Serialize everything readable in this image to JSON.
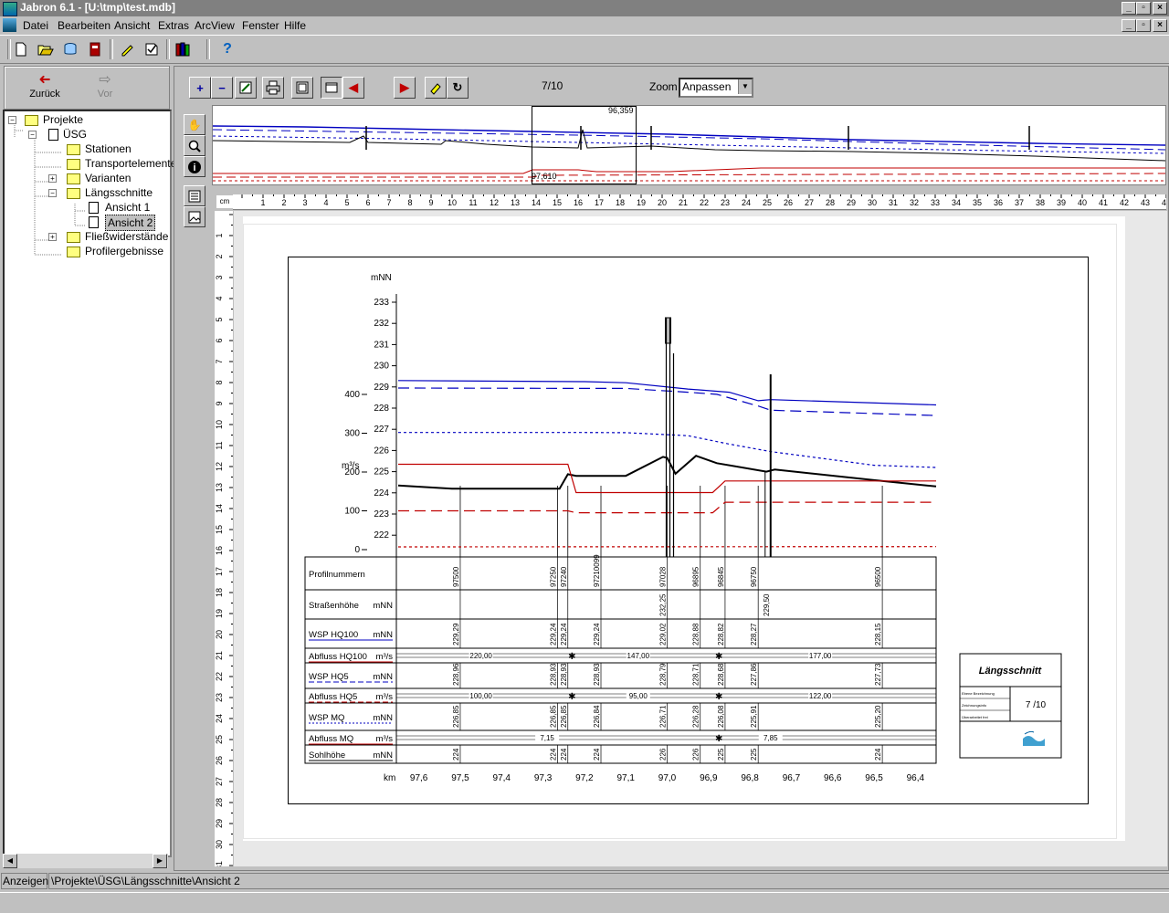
{
  "window": {
    "title": "Jabron 6.1 - [U:\\tmp\\test.mdb]"
  },
  "menu": {
    "items": [
      "Datei",
      "Bearbeiten",
      "Ansicht",
      "Extras",
      "ArcView",
      "Fenster",
      "Hilfe"
    ]
  },
  "nav": {
    "back": "Zurück",
    "forward": "Vor"
  },
  "tree": {
    "root": "Projekte",
    "project": "ÜSG",
    "items": [
      "Stationen",
      "Transportelemente",
      "Varianten",
      "Längsschnitte",
      "Fließwiderstände",
      "Profilergebnisse"
    ],
    "views": [
      "Ansicht 1",
      "Ansicht 2"
    ],
    "selected": "Ansicht 2"
  },
  "viewer": {
    "page": "7/10",
    "zoom_label": "Zoom",
    "zoom_value": "Anpassen",
    "ruler_unit": "cm"
  },
  "overview": {
    "top_value": "96,359",
    "bottom_value": "97,610"
  },
  "status": {
    "mode": "Anzeigen",
    "path": "\\Projekte\\ÜSG\\Längsschnitte\\Ansicht 2"
  },
  "title_block": {
    "title": "Längsschnitt",
    "page": "7 /10",
    "rows": [
      "Ebene Bezeichnung",
      "Zeichnungsinfo",
      "Überarbeitet frei"
    ]
  },
  "colors": {
    "wsp_hq100": "#0000c0",
    "abfluss": "#c00000",
    "ground": "#000000",
    "highlight": "#808080"
  },
  "chart_data": {
    "type": "line",
    "title": "",
    "ylabel": "mNN",
    "ylabel2": "m³/s",
    "xlabel": "km",
    "x_ticks": [
      "97,6",
      "97,5",
      "97,4",
      "97,3",
      "97,2",
      "97,1",
      "97,0",
      "96,9",
      "96,8",
      "96,7",
      "96,6",
      "96,5",
      "96,4"
    ],
    "y_ticks": [
      "222",
      "223",
      "224",
      "225",
      "226",
      "227",
      "228",
      "229",
      "230",
      "231",
      "232",
      "233"
    ],
    "y2_ticks": [
      "0",
      "100",
      "200",
      "300",
      "400"
    ],
    "xlim": [
      97.65,
      96.35
    ],
    "ylim": [
      221,
      233
    ],
    "series": [
      {
        "name": "WSP HQ100",
        "color": "#0000c0",
        "dash": "solid",
        "x": [
          97.65,
          97.2,
          97.1,
          96.95,
          96.85,
          96.78,
          96.75,
          96.35
        ],
        "y": [
          229.3,
          229.25,
          229.2,
          228.9,
          228.75,
          228.35,
          228.4,
          228.15
        ]
      },
      {
        "name": "WSP HQ5",
        "color": "#0000c0",
        "dash": "long",
        "x": [
          97.65,
          97.2,
          97.1,
          96.95,
          96.88,
          96.78,
          96.75,
          96.35
        ],
        "y": [
          228.95,
          228.93,
          228.93,
          228.75,
          228.65,
          228.1,
          227.9,
          227.65
        ]
      },
      {
        "name": "WSP MQ",
        "color": "#0000c0",
        "dash": "short",
        "x": [
          97.65,
          97.2,
          97.1,
          96.95,
          96.85,
          96.75,
          96.5,
          96.35
        ],
        "y": [
          226.85,
          226.85,
          226.84,
          226.7,
          226.3,
          225.95,
          225.3,
          225.2
        ]
      },
      {
        "name": "Sohlhöhe",
        "color": "#000000",
        "dash": "solid",
        "x": [
          97.65,
          97.52,
          97.26,
          97.24,
          97.22,
          97.1,
          97.01,
          97.0,
          96.98,
          96.93,
          96.88,
          96.76,
          96.74,
          96.5,
          96.35
        ],
        "y": [
          224.35,
          224.2,
          224.2,
          224.88,
          224.8,
          224.8,
          225.7,
          225.65,
          224.9,
          225.75,
          225.4,
          225.0,
          225.1,
          224.6,
          224.3
        ]
      },
      {
        "name": "Abfluss HQ100",
        "color": "#c00000",
        "dash": "solid",
        "x": [
          97.65,
          97.24,
          97.22,
          96.89,
          96.86,
          96.35
        ],
        "y": [
          220,
          220,
          147,
          147,
          177,
          177
        ]
      },
      {
        "name": "Abfluss HQ5",
        "color": "#c00000",
        "dash": "long",
        "x": [
          97.65,
          97.24,
          97.22,
          96.89,
          96.86,
          96.35
        ],
        "y": [
          100,
          100,
          95,
          95,
          122,
          122
        ]
      },
      {
        "name": "Abfluss MQ",
        "color": "#c00000",
        "dash": "short",
        "x": [
          97.65,
          96.35
        ],
        "y": [
          7.15,
          7.85
        ]
      }
    ],
    "stations": [
      {
        "id": "97500",
        "km": 97.5
      },
      {
        "id": "97250",
        "km": 97.265
      },
      {
        "id": "97240",
        "km": 97.24
      },
      {
        "id": "97210099",
        "km": 97.16
      },
      {
        "id": "97028",
        "km": 97.0
      },
      {
        "id": "96895",
        "km": 96.92
      },
      {
        "id": "96845",
        "km": 96.86
      },
      {
        "id": "96750",
        "km": 96.78
      },
      {
        "id": "96500",
        "km": 96.48
      }
    ],
    "table_rows": [
      {
        "label": "Profilnummern",
        "unit": ""
      },
      {
        "label": "Straßenhöhe",
        "unit": "mNN"
      },
      {
        "label": "WSP HQ100",
        "unit": "mNN"
      },
      {
        "label": "Abfluss HQ100",
        "unit": "m³/s"
      },
      {
        "label": "WSP HQ5",
        "unit": "mNN"
      },
      {
        "label": "Abfluss HQ5",
        "unit": "m³/s"
      },
      {
        "label": "WSP MQ",
        "unit": "mNN"
      },
      {
        "label": "Abfluss MQ",
        "unit": "m³/s"
      },
      {
        "label": "Sohlhöhe",
        "unit": "mNN"
      }
    ],
    "strassenhoehe": [
      {
        "km": 97.0,
        "v": "232,25"
      },
      {
        "km": 96.75,
        "v": "229,50"
      }
    ],
    "wsp_hq100": [
      {
        "km": 97.5,
        "v": "229,29"
      },
      {
        "km": 97.265,
        "v": "229,24"
      },
      {
        "km": 97.24,
        "v": "229,24"
      },
      {
        "km": 97.16,
        "v": "229,24"
      },
      {
        "km": 97.0,
        "v": "229,02"
      },
      {
        "km": 96.92,
        "v": "228,88"
      },
      {
        "km": 96.86,
        "v": "228,82"
      },
      {
        "km": 96.78,
        "v": "228,27"
      },
      {
        "km": 96.48,
        "v": "228,15"
      }
    ],
    "abfluss_hq100": [
      {
        "km": 97.45,
        "v": "220,00"
      },
      {
        "km": 97.07,
        "v": "147,00"
      },
      {
        "km": 96.63,
        "v": "177,00"
      }
    ],
    "wsp_hq5": [
      {
        "km": 97.5,
        "v": "228,96"
      },
      {
        "km": 97.265,
        "v": "228,93"
      },
      {
        "km": 97.24,
        "v": "228,93"
      },
      {
        "km": 97.16,
        "v": "228,93"
      },
      {
        "km": 97.0,
        "v": "228,79"
      },
      {
        "km": 96.92,
        "v": "228,71"
      },
      {
        "km": 96.86,
        "v": "228,68"
      },
      {
        "km": 96.78,
        "v": "227,86"
      },
      {
        "km": 96.48,
        "v": "227,73"
      }
    ],
    "abfluss_hq5": [
      {
        "km": 97.45,
        "v": "100,00"
      },
      {
        "km": 97.07,
        "v": "95,00"
      },
      {
        "km": 96.63,
        "v": "122,00"
      }
    ],
    "wsp_mq": [
      {
        "km": 97.5,
        "v": "226,85"
      },
      {
        "km": 97.265,
        "v": "226,85"
      },
      {
        "km": 97.24,
        "v": "226,85"
      },
      {
        "km": 97.16,
        "v": "226,84"
      },
      {
        "km": 97.0,
        "v": "226,71"
      },
      {
        "km": 96.92,
        "v": "226,28"
      },
      {
        "km": 96.86,
        "v": "226,08"
      },
      {
        "km": 96.78,
        "v": "225,91"
      },
      {
        "km": 96.48,
        "v": "225,20"
      }
    ],
    "abfluss_mq": [
      {
        "km": 97.29,
        "v": "7,15"
      },
      {
        "km": 96.75,
        "v": "7,85"
      }
    ],
    "sohlhoehe": [
      {
        "km": 97.5,
        "v": "224"
      },
      {
        "km": 97.265,
        "v": "224"
      },
      {
        "km": 97.24,
        "v": "224"
      },
      {
        "km": 97.16,
        "v": "224"
      },
      {
        "km": 97.0,
        "v": "226"
      },
      {
        "km": 96.92,
        "v": "226"
      },
      {
        "km": 96.86,
        "v": "225"
      },
      {
        "km": 96.78,
        "v": "225"
      },
      {
        "km": 96.48,
        "v": "224"
      }
    ]
  }
}
